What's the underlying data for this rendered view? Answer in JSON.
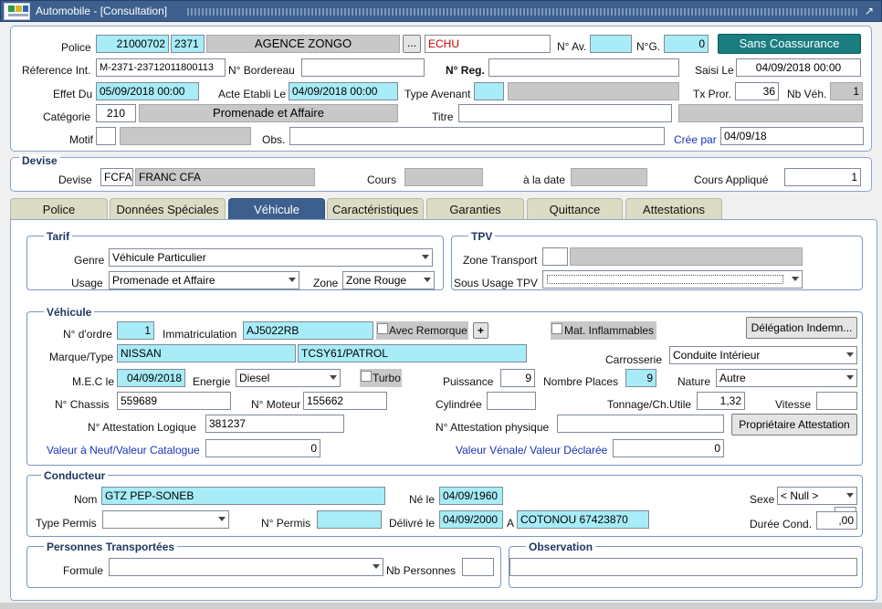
{
  "window": {
    "title": "Automobile - [Consultation]",
    "maximize_glyph": "↗"
  },
  "police_row": {
    "police_label": "Police",
    "police_no": "21000702",
    "branch_code": "2371",
    "agency": "AGENCE ZONGO",
    "browse_glyph": "...",
    "status": "ECHU",
    "av_label": "N° Av.",
    "av_value": "",
    "ng_label": "N°G.",
    "ng_value": "0",
    "coassurance_button": "Sans Coassurance"
  },
  "ref_row": {
    "ref_label": "Réference Int.",
    "ref_value": "M-2371-23712011800113",
    "bordereau_label": "N° Bordereau",
    "bordereau_value": "",
    "reg_label": "N° Reg.",
    "reg_value": "",
    "saisi_label": "Saisi Le",
    "saisi_value": "04/09/2018 00:00"
  },
  "effet_row": {
    "effet_label": "Effet Du",
    "effet_value": "05/09/2018 00:00",
    "acte_label": "Acte Etabli Le",
    "acte_value": "04/09/2018 00:00",
    "avenant_label": "Type Avenant",
    "avenant_code": "",
    "avenant_desc": "",
    "tx_label": "Tx Pror.",
    "tx_value": "36",
    "nbveh_label": "Nb Véh.",
    "nbveh_value": "1"
  },
  "categorie_row": {
    "cat_label": "Catégorie",
    "cat_code": "210",
    "cat_desc": "Promenade et Affaire",
    "titre_label": "Titre",
    "titre_value": "",
    "titre_extra": ""
  },
  "motif_row": {
    "motif_label": "Motif",
    "motif_code": "",
    "motif_desc": "",
    "obs_label": "Obs.",
    "obs_value": "",
    "creepar_label": "Crée par",
    "creepar_value": "04/09/18"
  },
  "devise": {
    "group_label": "Devise",
    "devise_label": "Devise",
    "code": "FCFA",
    "name": "FRANC CFA",
    "cours_label": "Cours",
    "cours_value": "",
    "date_label": "à la date",
    "date_value": "",
    "applique_label": "Cours  Appliqué",
    "applique_value": "1"
  },
  "tabs": [
    {
      "label": "Police"
    },
    {
      "label": "Données Spéciales"
    },
    {
      "label": "Véhicule"
    },
    {
      "label": "Caractéristiques"
    },
    {
      "label": "Garanties"
    },
    {
      "label": "Quittance"
    },
    {
      "label": "Attestations"
    }
  ],
  "tarif": {
    "group_label": "Tarif",
    "genre_label": "Genre",
    "genre_value": "Véhicule Particulier",
    "usage_label": "Usage",
    "usage_value": "Promenade et Affaire",
    "zone_label": "Zone",
    "zone_value": "Zone Rouge"
  },
  "tpv": {
    "group_label": "TPV",
    "zone_label": "Zone Transport",
    "zone_code": "",
    "zone_desc": "",
    "sous_label": "Sous Usage TPV",
    "sous_value": ""
  },
  "vehicule": {
    "group_label": "Véhicule",
    "ordre_label": "N° d'ordre",
    "ordre_value": "1",
    "immat_label": "Immatriculation",
    "immat_value": "AJ5022RB",
    "remorque_label": "Avec Remorque",
    "plus_glyph": "+",
    "inflam_label": "Mat. Inflammables",
    "delegation_button": "Délégation Indemn...",
    "marque_label": "Marque/Type",
    "marque_value": "NISSAN",
    "type_value": "TCSY61/PATROL",
    "carrosserie_label": "Carrosserie",
    "carrosserie_value": "Conduite Intérieur",
    "mec_label": "M.E.C le",
    "mec_value": "04/09/2018",
    "energie_label": "Energie",
    "energie_value": "Diesel",
    "turbo_label": "Turbo",
    "puissance_label": "Puissance",
    "puissance_value": "9",
    "places_label": "Nombre Places",
    "places_value": "9",
    "nature_label": "Nature",
    "nature_value": "Autre",
    "chassis_label": "N° Chassis",
    "chassis_value": "559689",
    "moteur_label": "N° Moteur",
    "moteur_value": "155662",
    "cylindree_label": "Cylindrée",
    "cylindree_value": "",
    "tonnage_label": "Tonnage/Ch.Utile",
    "tonnage_value": "1,32",
    "vitesse_label": "Vitesse",
    "vitesse_value": "",
    "attlog_label": "N° Attestation Logique",
    "attlog_value": "381237",
    "attphys_label": "N° Attestation physique",
    "attphys_value": "",
    "proprio_button": "Propriétaire Attestation",
    "neuf_label": "Valeur à Neuf/Valeur Catalogue",
    "neuf_value": "0",
    "venale_label": "Valeur Vénale/ Valeur Déclarée",
    "venale_value": "0"
  },
  "conducteur": {
    "group_label": "Conducteur",
    "nom_label": "Nom",
    "nom_value": "GTZ PEP-SONEB",
    "ne_label": "Né le",
    "ne_value": "04/09/1960",
    "sexe_label": "Sexe",
    "sexe_value": "< Null >",
    "permis_type_label": "Type Permis",
    "permis_type_value": "",
    "permis_label": "N° Permis",
    "permis_value": "",
    "delivre_label": "Délivré le",
    "delivre_value": "04/09/2000",
    "a_label": "A",
    "lieu_value": "COTONOU 67423870",
    "duree_label": "Durée Cond.",
    "duree_value": ",00"
  },
  "personnes": {
    "group_label": "Personnes Transportées",
    "formule_label": "Formule",
    "formule_value": "",
    "nb_label": "Nb Personnes",
    "nb_value": ""
  },
  "observation": {
    "group_label": "Observation",
    "value": ""
  }
}
